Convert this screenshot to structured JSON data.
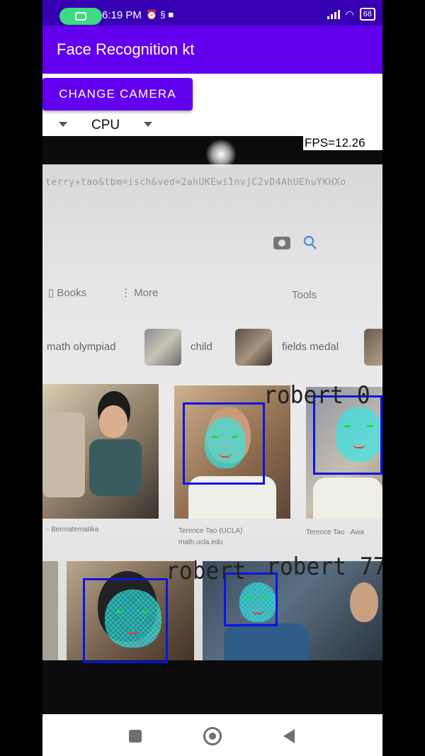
{
  "status_bar": {
    "time": "6:19 PM",
    "icons": [
      "screen-record-icon",
      "alarm-icon",
      "sync-icon",
      "video-icon",
      "signal-icon",
      "wifi-icon",
      "battery-icon"
    ],
    "battery_level": "68"
  },
  "app_bar": {
    "title": "Face Recognition kt"
  },
  "controls": {
    "change_camera_label": "CHANGE CAMERA",
    "device_selected": "CPU"
  },
  "preview": {
    "fps_text": "FPS=12.26",
    "url_text": "terry+tao&tbm=isch&ved=2ahUKEwi1nvjC2vD4AhUEhuYKHXo",
    "tabs": {
      "books": "Books",
      "more": "More",
      "tools": "Tools"
    },
    "chips": [
      "math olympiad",
      "child",
      "fields medal"
    ],
    "captions": [
      "- Bermatematika",
      "Terence Tao (UCLA)",
      "Terence Tao · Awa",
      "math.ucla.edu"
    ],
    "face_labels": [
      "robert 0",
      "robert",
      "robert 77"
    ]
  },
  "colors": {
    "status_bar": "#3700b3",
    "primary": "#6200ee",
    "face_box": "#0a14e6",
    "face_mesh": "#46dcdc"
  }
}
